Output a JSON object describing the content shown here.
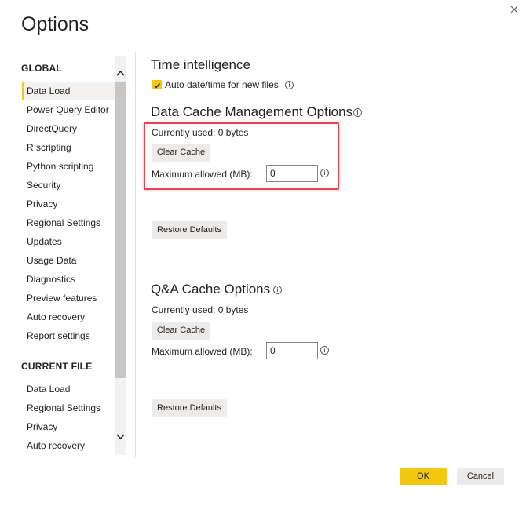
{
  "dialog": {
    "title": "Options",
    "ok_label": "OK",
    "cancel_label": "Cancel"
  },
  "sidebar": {
    "global_header": "GLOBAL",
    "global_items": [
      {
        "label": "Data Load",
        "active": true
      },
      {
        "label": "Power Query Editor"
      },
      {
        "label": "DirectQuery"
      },
      {
        "label": "R scripting"
      },
      {
        "label": "Python scripting"
      },
      {
        "label": "Security"
      },
      {
        "label": "Privacy"
      },
      {
        "label": "Regional Settings"
      },
      {
        "label": "Updates"
      },
      {
        "label": "Usage Data"
      },
      {
        "label": "Diagnostics"
      },
      {
        "label": "Preview features"
      },
      {
        "label": "Auto recovery"
      },
      {
        "label": "Report settings"
      }
    ],
    "current_file_header": "CURRENT FILE",
    "current_file_items": [
      {
        "label": "Data Load"
      },
      {
        "label": "Regional Settings"
      },
      {
        "label": "Privacy"
      },
      {
        "label": "Auto recovery"
      }
    ]
  },
  "time_intelligence": {
    "heading": "Time intelligence",
    "auto_datetime_label": "Auto date/time for new files",
    "auto_datetime_checked": true
  },
  "data_cache": {
    "heading": "Data Cache Management Options",
    "currently_used": "Currently used: 0 bytes",
    "clear_cache_label": "Clear Cache",
    "max_allowed_label": "Maximum allowed (MB):",
    "max_allowed_value": "0",
    "restore_defaults_label": "Restore Defaults"
  },
  "qa_cache": {
    "heading": "Q&A Cache Options",
    "currently_used": "Currently used: 0 bytes",
    "clear_cache_label": "Clear Cache",
    "max_allowed_label": "Maximum allowed (MB):",
    "max_allowed_value": "0",
    "restore_defaults_label": "Restore Defaults"
  },
  "colors": {
    "accent": "#f2c811",
    "highlight": "#e0474c",
    "button_bg": "#edebe9"
  },
  "icons": [
    "close-icon",
    "info-icon",
    "checkmark-icon",
    "chevron-up-icon",
    "chevron-down-icon"
  ]
}
